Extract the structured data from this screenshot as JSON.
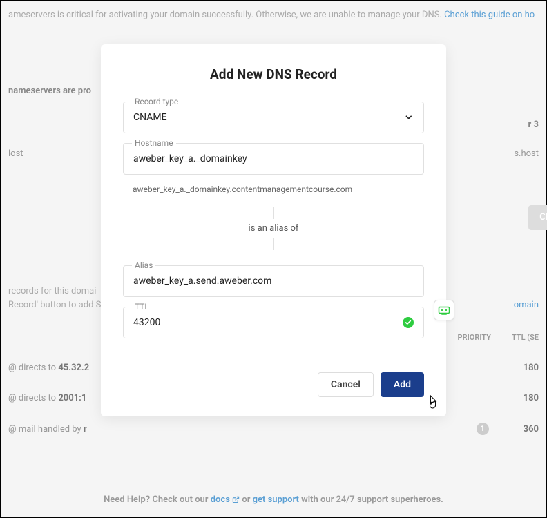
{
  "background": {
    "banner_prefix": "ameservers is critical for activating your domain successfully. Otherwise, we are unable to manage your DNS. ",
    "banner_link": "Check this guide on ho",
    "ns_label": "nameservers are pro",
    "ns_r3": "r 3",
    "host_left": "lost",
    "host_right": "s.host",
    "check_btn": "Che",
    "records_line1": "records for this domai",
    "records_line2": "Record' button to add S",
    "records_line2_link": "omain",
    "header_priority": "PRIORITY",
    "header_ttl": "TTL (SE",
    "row1_prefix": "@ directs to ",
    "row1_bold": "45.32.2",
    "row1_ttl": "180",
    "row2_prefix": "@ directs to ",
    "row2_bold": "2001:1",
    "row2_ttl": "180",
    "row3_prefix": "@ mail handled by ",
    "row3_bold": "r",
    "row3_priority": "1",
    "row3_ttl": "360",
    "footer_prefix": "Need Help? Check out our ",
    "footer_docs": "docs",
    "footer_mid": " or ",
    "footer_support": "get support",
    "footer_suffix": " with our 24/7 support superheroes."
  },
  "modal": {
    "title": "Add New DNS Record",
    "record_type_label": "Record type",
    "record_type_value": "CNAME",
    "hostname_label": "Hostname",
    "hostname_value": "aweber_key_a._domainkey",
    "hostname_helper": "aweber_key_a._domainkey.contentmanagementcourse.com",
    "alias_of_text": "is an alias of",
    "alias_label": "Alias",
    "alias_value": "aweber_key_a.send.aweber.com",
    "ttl_label": "TTL",
    "ttl_value": "43200",
    "cancel_btn": "Cancel",
    "add_btn": "Add"
  }
}
